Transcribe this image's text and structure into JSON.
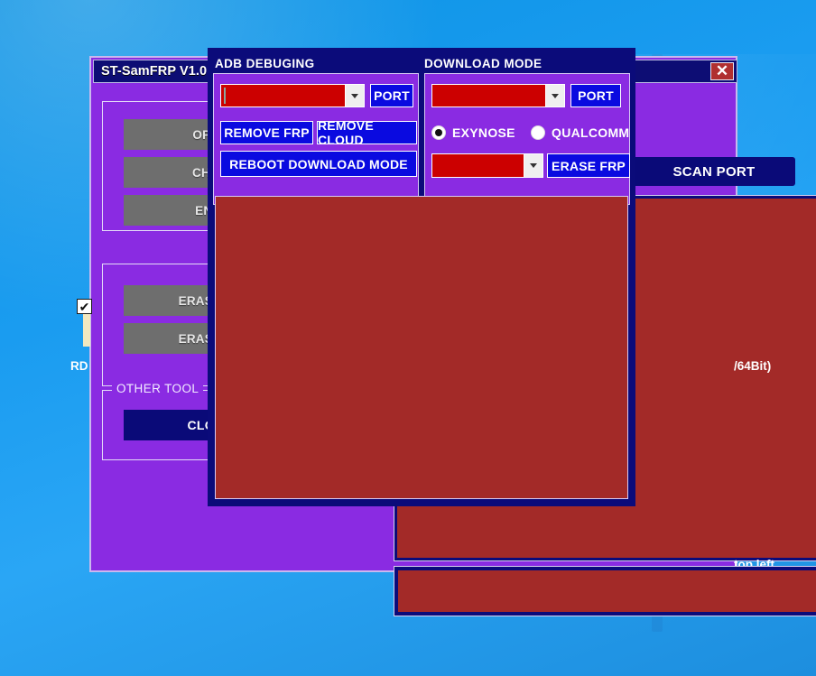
{
  "desktop": {
    "wallpaper": "windows-blue",
    "accent": "#1a9cf0"
  },
  "main_window": {
    "title": "ST-SamFRP V1.0",
    "close_label": "✕",
    "scan_port_label": "SCAN PORT",
    "group_one": {
      "buttons": [
        {
          "label": "OPEN US"
        },
        {
          "label": "CHECK D"
        },
        {
          "label": "ENABLE"
        }
      ]
    },
    "group_two": {
      "buttons": [
        {
          "label": "ERASE FRP-U"
        },
        {
          "label": "ERASE FRP-U"
        }
      ]
    },
    "other_tool": {
      "legend": "OTHER TOOL",
      "button_label": "CLOSE SA"
    },
    "left_checkbox": {
      "checked_glyph": "✔"
    },
    "stray_label": "RD",
    "log": {
      "line_right": "/64Bit)",
      "line_bottom": "top left"
    }
  },
  "dialog": {
    "adb_panel": {
      "title": "ADB DEBUGING",
      "combo": {
        "value": "",
        "placeholder": ""
      },
      "port_label": "PORT",
      "buttons": [
        {
          "label": "REMOVE FRP"
        },
        {
          "label": "REMOVE CLOUD"
        },
        {
          "label": "REBOOT DOWNLOAD MODE"
        }
      ]
    },
    "download_panel": {
      "title": "DOWNLOAD MODE",
      "combo": {
        "value": "",
        "placeholder": ""
      },
      "port_label": "PORT",
      "radios": [
        {
          "label": "EXYNOSE",
          "selected": true
        },
        {
          "label": "QUALCOMM",
          "selected": false
        }
      ],
      "combo2": {
        "value": "",
        "placeholder": ""
      },
      "erase_frp_label": "ERASE FRP"
    },
    "log_text": ""
  },
  "colors": {
    "navy": "#0b0b7a",
    "purple": "#8a2be2",
    "log_red": "#a32a28",
    "combo_red": "#cc0000",
    "button_blue": "#0a0ae0",
    "gray_button": "#6e6e6e",
    "close_red": "#b03030"
  }
}
